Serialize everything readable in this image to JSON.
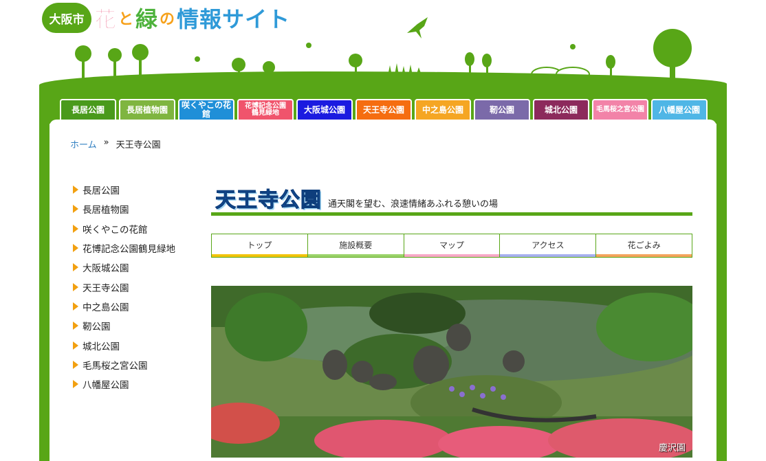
{
  "header": {
    "city_label": "大阪市",
    "title_part1": "花",
    "title_part2": "と",
    "title_part3": "緑",
    "title_part4": "の",
    "title_part5": "情報サイト"
  },
  "nav": {
    "tabs": [
      {
        "label": "長居公園",
        "color": "#4a9a1c"
      },
      {
        "label": "長居植物園",
        "color": "#7fb540"
      },
      {
        "label": "咲くやこの花館",
        "color": "#1f8fd8"
      },
      {
        "label": "花博記念公園\n鶴見緑地",
        "color": "#f0546c"
      },
      {
        "label": "大阪城公園",
        "color": "#1b1be0"
      },
      {
        "label": "天王寺公園",
        "color": "#f56d10"
      },
      {
        "label": "中之島公園",
        "color": "#f5a623"
      },
      {
        "label": "靭公園",
        "color": "#7b6aa9"
      },
      {
        "label": "城北公園",
        "color": "#8c2a5c"
      },
      {
        "label": "毛馬桜之宮公園",
        "color": "#f283a8"
      },
      {
        "label": "八幡屋公園",
        "color": "#4fb6e6"
      }
    ]
  },
  "breadcrumb": {
    "home": "ホーム",
    "separator": "»",
    "current": "天王寺公園"
  },
  "sidebar": {
    "items": [
      "長居公園",
      "長居植物園",
      "咲くやこの花館",
      "花博記念公園鶴見緑地",
      "大阪城公園",
      "天王寺公園",
      "中之島公園",
      "靭公園",
      "城北公園",
      "毛馬桜之宮公園",
      "八幡屋公園"
    ]
  },
  "main": {
    "park_title": "天王寺公園",
    "park_subtitle": "通天閣を望む、浪速情緒あふれる憩いの場",
    "subtabs": [
      {
        "label": "トップ",
        "color": "#f2c40c"
      },
      {
        "label": "施設概要",
        "color": "#9bd36a"
      },
      {
        "label": "マップ",
        "color": "#f7a8c8"
      },
      {
        "label": "アクセス",
        "color": "#a7b0ef"
      },
      {
        "label": "花ごよみ",
        "color": "#f4a45c"
      }
    ],
    "photo_caption": "慶沢園"
  },
  "colors": {
    "brand_green": "#58a617",
    "link_blue": "#2f7fc1"
  }
}
